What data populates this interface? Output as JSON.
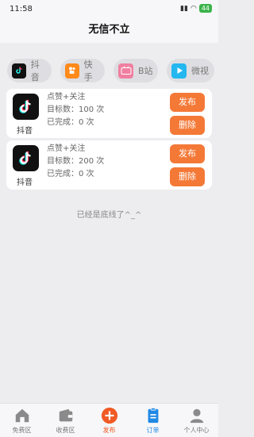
{
  "status": {
    "time": "11:58",
    "battery": "44"
  },
  "header": {
    "title": "无信不立"
  },
  "platforms": [
    {
      "label": "抖音",
      "icon": "douyin-icon",
      "color": "#111111"
    },
    {
      "label": "快手",
      "icon": "kuaishou-icon",
      "color": "#ff8a1a"
    },
    {
      "label": "B站",
      "icon": "bilibili-icon",
      "color": "#f07fa0"
    },
    {
      "label": "微视",
      "icon": "weishi-icon",
      "color": "#24b7f0"
    }
  ],
  "orders": [
    {
      "platform": "抖音",
      "task": "点赞+关注",
      "target": "目标数：100 次",
      "done": "已完成：0 次",
      "publish": "发布",
      "delete": "删除"
    },
    {
      "platform": "抖音",
      "task": "点赞+关注",
      "target": "目标数：200 次",
      "done": "已完成：0 次",
      "publish": "发布",
      "delete": "删除"
    }
  ],
  "end_text": "已经是底线了^_^",
  "tabs": [
    {
      "label": "免费区",
      "icon": "home-icon"
    },
    {
      "label": "收费区",
      "icon": "wallet-icon"
    },
    {
      "label": "发布",
      "icon": "plus-icon"
    },
    {
      "label": "订单",
      "icon": "order-icon"
    },
    {
      "label": "个人中心",
      "icon": "user-icon"
    }
  ],
  "colors": {
    "accent": "#f47937",
    "tab_active": "#1e88e5"
  }
}
